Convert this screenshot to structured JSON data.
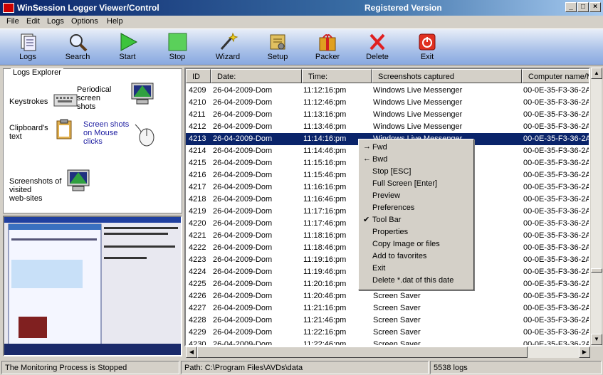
{
  "window": {
    "title": "WinSession Logger  Viewer/Control",
    "registration": "Registered Version",
    "minimize": "_",
    "maximize": "□",
    "close": "×"
  },
  "menu": [
    "File",
    "Edit",
    "Logs",
    "Options",
    "Help"
  ],
  "toolbar": [
    {
      "label": "Logs",
      "icon": "logs-icon"
    },
    {
      "label": "Search",
      "icon": "search-icon"
    },
    {
      "label": "Start",
      "icon": "play-icon"
    },
    {
      "label": "Stop",
      "icon": "stop-icon"
    },
    {
      "label": "Wizard",
      "icon": "wand-icon"
    },
    {
      "label": "Setup",
      "icon": "setup-icon"
    },
    {
      "label": "Packer",
      "icon": "package-icon"
    },
    {
      "label": "Delete",
      "icon": "delete-icon"
    },
    {
      "label": "Exit",
      "icon": "exit-icon"
    }
  ],
  "explorer": {
    "title": "Logs Explorer",
    "keystrokes": "Keystrokes",
    "periodical": [
      "Periodical",
      "screen",
      "shots"
    ],
    "clipboard": [
      "Clipboard's",
      "text"
    ],
    "mouse_clicks": [
      "Screen shots",
      "on Mouse",
      "clicks"
    ],
    "websites": [
      "Screenshots of",
      "visited",
      "web-sites"
    ]
  },
  "grid": {
    "columns": [
      "ID",
      "Date:",
      "Time:",
      "Screenshots captured",
      "Computer name/M"
    ],
    "rows": [
      {
        "id": "4209",
        "date": "26-04-2009-Dom",
        "time": "11:12:16:pm",
        "shot": "Windows Live Messenger",
        "computer": "00-0E-35-F3-36-2A"
      },
      {
        "id": "4210",
        "date": "26-04-2009-Dom",
        "time": "11:12:46:pm",
        "shot": "Windows Live Messenger",
        "computer": "00-0E-35-F3-36-2A"
      },
      {
        "id": "4211",
        "date": "26-04-2009-Dom",
        "time": "11:13:16:pm",
        "shot": "Windows Live Messenger",
        "computer": "00-0E-35-F3-36-2A"
      },
      {
        "id": "4212",
        "date": "26-04-2009-Dom",
        "time": "11:13:46:pm",
        "shot": "Windows Live Messenger",
        "computer": "00-0E-35-F3-36-2A"
      },
      {
        "id": "4213",
        "date": "26-04-2009-Dom",
        "time": "11:14:16:pm",
        "shot": "Windows Live Messenger",
        "computer": "00-0E-35-F3-36-2A"
      },
      {
        "id": "4214",
        "date": "26-04-2009-Dom",
        "time": "11:14:46:pm",
        "shot": "",
        "computer": "00-0E-35-F3-36-2A"
      },
      {
        "id": "4215",
        "date": "26-04-2009-Dom",
        "time": "11:15:16:pm",
        "shot": "",
        "computer": "00-0E-35-F3-36-2A"
      },
      {
        "id": "4216",
        "date": "26-04-2009-Dom",
        "time": "11:15:46:pm",
        "shot": "",
        "computer": "00-0E-35-F3-36-2A"
      },
      {
        "id": "4217",
        "date": "26-04-2009-Dom",
        "time": "11:16:16:pm",
        "shot": "",
        "computer": "00-0E-35-F3-36-2A"
      },
      {
        "id": "4218",
        "date": "26-04-2009-Dom",
        "time": "11:16:46:pm",
        "shot": "",
        "computer": "00-0E-35-F3-36-2A"
      },
      {
        "id": "4219",
        "date": "26-04-2009-Dom",
        "time": "11:17:16:pm",
        "shot": "",
        "computer": "00-0E-35-F3-36-2A"
      },
      {
        "id": "4220",
        "date": "26-04-2009-Dom",
        "time": "11:17:46:pm",
        "shot": "",
        "computer": "00-0E-35-F3-36-2A"
      },
      {
        "id": "4221",
        "date": "26-04-2009-Dom",
        "time": "11:18:16:pm",
        "shot": "",
        "computer": "00-0E-35-F3-36-2A"
      },
      {
        "id": "4222",
        "date": "26-04-2009-Dom",
        "time": "11:18:46:pm",
        "shot": "",
        "computer": "00-0E-35-F3-36-2A"
      },
      {
        "id": "4223",
        "date": "26-04-2009-Dom",
        "time": "11:19:16:pm",
        "shot": "",
        "computer": "00-0E-35-F3-36-2A"
      },
      {
        "id": "4224",
        "date": "26-04-2009-Dom",
        "time": "11:19:46:pm",
        "shot": "",
        "computer": "00-0E-35-F3-36-2A"
      },
      {
        "id": "4225",
        "date": "26-04-2009-Dom",
        "time": "11:20:16:pm",
        "shot": "",
        "computer": "00-0E-35-F3-36-2A"
      },
      {
        "id": "4226",
        "date": "26-04-2009-Dom",
        "time": "11:20:46:pm",
        "shot": "Screen Saver",
        "computer": "00-0E-35-F3-36-2A"
      },
      {
        "id": "4227",
        "date": "26-04-2009-Dom",
        "time": "11:21:16:pm",
        "shot": "Screen Saver",
        "computer": "00-0E-35-F3-36-2A"
      },
      {
        "id": "4228",
        "date": "26-04-2009-Dom",
        "time": "11:21:46:pm",
        "shot": "Screen Saver",
        "computer": "00-0E-35-F3-36-2A"
      },
      {
        "id": "4229",
        "date": "26-04-2009-Dom",
        "time": "11:22:16:pm",
        "shot": "Screen Saver",
        "computer": "00-0E-35-F3-36-2A"
      },
      {
        "id": "4230",
        "date": "26-04-2009-Dom",
        "time": "11:22:46:pm",
        "shot": "Screen Saver",
        "computer": "00-0E-35-F3-36-2A"
      }
    ]
  },
  "context_menu": [
    {
      "label": "Fwd",
      "mark": "→"
    },
    {
      "label": "Bwd",
      "mark": "←"
    },
    {
      "label": "Stop [ESC]",
      "mark": ""
    },
    {
      "label": "Full Screen [Enter]",
      "mark": ""
    },
    {
      "label": "Preview",
      "mark": ""
    },
    {
      "label": "Preferences",
      "mark": ""
    },
    {
      "label": "Tool Bar",
      "mark": "✔"
    },
    {
      "label": "Properties",
      "mark": ""
    },
    {
      "label": "Copy Image or files",
      "mark": ""
    },
    {
      "label": "Add to favorites",
      "mark": ""
    },
    {
      "label": "Exit",
      "mark": ""
    },
    {
      "label": "Delete *.dat of this date",
      "mark": ""
    }
  ],
  "status": {
    "monitoring": "The Monitoring Process is Stopped",
    "path": "Path: C:\\Program Files\\AVDs\\data",
    "count": "5538 logs"
  },
  "colors": {
    "selection": "#0a246a",
    "title_start": "#0a246a",
    "toolbar": "#a8c0e8"
  }
}
